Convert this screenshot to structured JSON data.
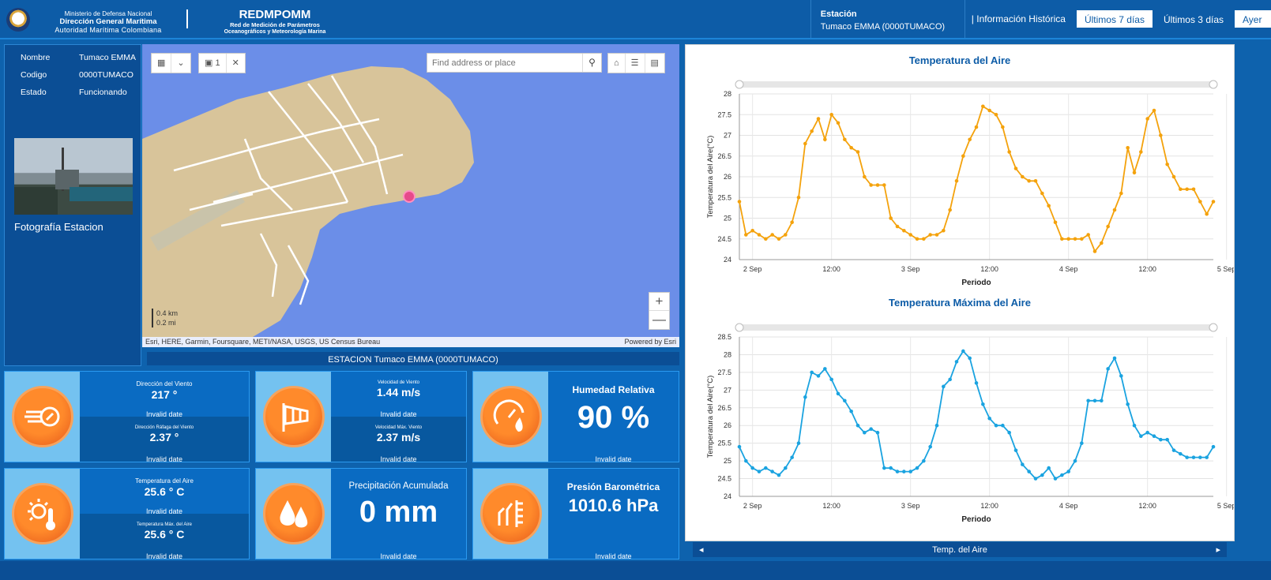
{
  "header": {
    "ministry": "Ministerio de Defensa Nacional",
    "dimar": "Dirección General Marítima",
    "authority": "Autoridad Marítima Colombiana",
    "app_title": "REDMPOMM",
    "subtitle_1": "Red de Medición de Parámetros",
    "subtitle_2": "Oceanográficos y Meteorología Marina",
    "station_label": "Estación",
    "station_value": "Tumaco EMMA (0000TUMACO)",
    "history_label": "| Información Histórica",
    "buttons": [
      "Últimos 7 días",
      "Últimos 3 días",
      "Ayer"
    ]
  },
  "station_info": {
    "rows": [
      {
        "key": "Nombre",
        "value": "Tumaco EMMA"
      },
      {
        "key": "Codigo",
        "value": "0000TUMACO"
      },
      {
        "key": "Estado",
        "value": "Funcionando"
      }
    ],
    "photo_label": "Fotografía Estacion"
  },
  "map": {
    "search_placeholder": "Find address or place",
    "tool_page": "1",
    "scale_km": "0.4 km",
    "scale_mi": "0.2 mi",
    "attribution": "Esri, HERE, Garmin, Foursquare, METI/NASA, USGS, US Census Bureau",
    "powered_by": "Powered by Esri",
    "zoom_in": "+",
    "zoom_out": "—",
    "caption": "ESTACION Tumaco EMMA (0000TUMACO)",
    "colors": {
      "water": "#6b8ee8",
      "land": "#d8c49a"
    }
  },
  "tiles": {
    "wind": {
      "label1": "Dirección del Viento",
      "value1": "217 °",
      "date1": "Invalid date",
      "label2": "Dirección Ráfaga del Viento",
      "value2": "2.37 °",
      "date2": "Invalid date"
    },
    "speed": {
      "label1": "Velocidad de Viento",
      "value1": "1.44 m/s",
      "date1": "Invalid date",
      "label2": "Velocidad Máx. Viento",
      "value2": "2.37 m/s",
      "date2": "Invalid date"
    },
    "humidity": {
      "label": "Humedad Relativa",
      "value": "90 %",
      "date": "Invalid date"
    },
    "temp": {
      "label1": "Temperatura del Aire",
      "value1": "25.6 ° C",
      "date1": "Invalid date",
      "label2": "Temperatura Máx. del Aire",
      "value2": "25.6 ° C",
      "date2": "Invalid date"
    },
    "precip": {
      "label": "Precipitación Acumulada",
      "value": "0 mm",
      "date": "Invalid date"
    },
    "pressure": {
      "label": "Presión Barométrica",
      "value": "1010.6 hPa",
      "date": "Invalid date"
    }
  },
  "footer": {
    "label": "Temp. del Aire",
    "prev": "◂",
    "next": "▸"
  },
  "chart_data": [
    {
      "type": "line",
      "title": "Temperatura del Aire",
      "xlabel": "Periodo",
      "ylabel": "Temperatura del Aire(°C)",
      "ylim": [
        24,
        28
      ],
      "yticks": [
        "24",
        "24.5",
        "25",
        "25.5",
        "26",
        "26.5",
        "27",
        "27.5",
        "28"
      ],
      "xticks": [
        "2 Sep",
        "12:00",
        "3 Sep",
        "12:00",
        "4 Sep",
        "12:00",
        "5 Sep"
      ],
      "x_range_hours": [
        0,
        72
      ],
      "color": "#f4a20c",
      "points": [
        [
          0,
          25.4
        ],
        [
          1,
          24.6
        ],
        [
          2,
          24.7
        ],
        [
          3,
          24.6
        ],
        [
          4,
          24.5
        ],
        [
          5,
          24.6
        ],
        [
          6,
          24.5
        ],
        [
          7,
          24.6
        ],
        [
          8,
          24.9
        ],
        [
          9,
          25.5
        ],
        [
          10,
          26.8
        ],
        [
          11,
          27.1
        ],
        [
          12,
          27.4
        ],
        [
          13,
          26.9
        ],
        [
          14,
          27.5
        ],
        [
          15,
          27.3
        ],
        [
          16,
          26.9
        ],
        [
          17,
          26.7
        ],
        [
          18,
          26.6
        ],
        [
          19,
          26.0
        ],
        [
          20,
          25.8
        ],
        [
          21,
          25.8
        ],
        [
          22,
          25.8
        ],
        [
          23,
          25.0
        ],
        [
          24,
          24.8
        ],
        [
          25,
          24.7
        ],
        [
          26,
          24.6
        ],
        [
          27,
          24.5
        ],
        [
          28,
          24.5
        ],
        [
          29,
          24.6
        ],
        [
          30,
          24.6
        ],
        [
          31,
          24.7
        ],
        [
          32,
          25.2
        ],
        [
          33,
          25.9
        ],
        [
          34,
          26.5
        ],
        [
          35,
          26.9
        ],
        [
          36,
          27.2
        ],
        [
          37,
          27.7
        ],
        [
          38,
          27.6
        ],
        [
          39,
          27.5
        ],
        [
          40,
          27.2
        ],
        [
          41,
          26.6
        ],
        [
          42,
          26.2
        ],
        [
          43,
          26.0
        ],
        [
          44,
          25.9
        ],
        [
          45,
          25.9
        ],
        [
          46,
          25.6
        ],
        [
          47,
          25.3
        ],
        [
          48,
          24.9
        ],
        [
          49,
          24.5
        ],
        [
          50,
          24.5
        ],
        [
          51,
          24.5
        ],
        [
          52,
          24.5
        ],
        [
          53,
          24.6
        ],
        [
          54,
          24.2
        ],
        [
          55,
          24.4
        ],
        [
          56,
          24.8
        ],
        [
          57,
          25.2
        ],
        [
          58,
          25.6
        ],
        [
          59,
          26.7
        ],
        [
          60,
          26.1
        ],
        [
          61,
          26.6
        ],
        [
          62,
          27.4
        ],
        [
          63,
          27.6
        ],
        [
          64,
          27.0
        ],
        [
          65,
          26.3
        ],
        [
          66,
          26.0
        ],
        [
          67,
          25.7
        ],
        [
          68,
          25.7
        ],
        [
          69,
          25.7
        ],
        [
          70,
          25.4
        ],
        [
          71,
          25.1
        ],
        [
          72,
          25.4
        ]
      ]
    },
    {
      "type": "line",
      "title": "Temperatura Máxima del Aire",
      "xlabel": "Periodo",
      "ylabel": "Temperatura del Aire(°C)",
      "ylim": [
        24,
        28.5
      ],
      "yticks": [
        "24",
        "24.5",
        "25",
        "25.5",
        "26",
        "26.5",
        "27",
        "27.5",
        "28",
        "28.5"
      ],
      "xticks": [
        "2 Sep",
        "12:00",
        "3 Sep",
        "12:00",
        "4 Sep",
        "12:00",
        "5 Sep"
      ],
      "x_range_hours": [
        0,
        72
      ],
      "color": "#1aa3e0",
      "points": [
        [
          0,
          25.4
        ],
        [
          1,
          25.0
        ],
        [
          2,
          24.8
        ],
        [
          3,
          24.7
        ],
        [
          4,
          24.8
        ],
        [
          5,
          24.7
        ],
        [
          6,
          24.6
        ],
        [
          7,
          24.8
        ],
        [
          8,
          25.1
        ],
        [
          9,
          25.5
        ],
        [
          10,
          26.8
        ],
        [
          11,
          27.5
        ],
        [
          12,
          27.4
        ],
        [
          13,
          27.6
        ],
        [
          14,
          27.3
        ],
        [
          15,
          26.9
        ],
        [
          16,
          26.7
        ],
        [
          17,
          26.4
        ],
        [
          18,
          26.0
        ],
        [
          19,
          25.8
        ],
        [
          20,
          25.9
        ],
        [
          21,
          25.8
        ],
        [
          22,
          24.8
        ],
        [
          23,
          24.8
        ],
        [
          24,
          24.7
        ],
        [
          25,
          24.7
        ],
        [
          26,
          24.7
        ],
        [
          27,
          24.8
        ],
        [
          28,
          25.0
        ],
        [
          29,
          25.4
        ],
        [
          30,
          26.0
        ],
        [
          31,
          27.1
        ],
        [
          32,
          27.3
        ],
        [
          33,
          27.8
        ],
        [
          34,
          28.1
        ],
        [
          35,
          27.9
        ],
        [
          36,
          27.2
        ],
        [
          37,
          26.6
        ],
        [
          38,
          26.2
        ],
        [
          39,
          26.0
        ],
        [
          40,
          26.0
        ],
        [
          41,
          25.8
        ],
        [
          42,
          25.3
        ],
        [
          43,
          24.9
        ],
        [
          44,
          24.7
        ],
        [
          45,
          24.5
        ],
        [
          46,
          24.6
        ],
        [
          47,
          24.8
        ],
        [
          48,
          24.5
        ],
        [
          49,
          24.6
        ],
        [
          50,
          24.7
        ],
        [
          51,
          25.0
        ],
        [
          52,
          25.5
        ],
        [
          53,
          26.7
        ],
        [
          54,
          26.7
        ],
        [
          55,
          26.7
        ],
        [
          56,
          27.6
        ],
        [
          57,
          27.9
        ],
        [
          58,
          27.4
        ],
        [
          59,
          26.6
        ],
        [
          60,
          26.0
        ],
        [
          61,
          25.7
        ],
        [
          62,
          25.8
        ],
        [
          63,
          25.7
        ],
        [
          64,
          25.6
        ],
        [
          65,
          25.6
        ],
        [
          66,
          25.3
        ],
        [
          67,
          25.2
        ],
        [
          68,
          25.1
        ],
        [
          69,
          25.1
        ],
        [
          70,
          25.1
        ],
        [
          71,
          25.1
        ],
        [
          72,
          25.4
        ]
      ]
    }
  ]
}
